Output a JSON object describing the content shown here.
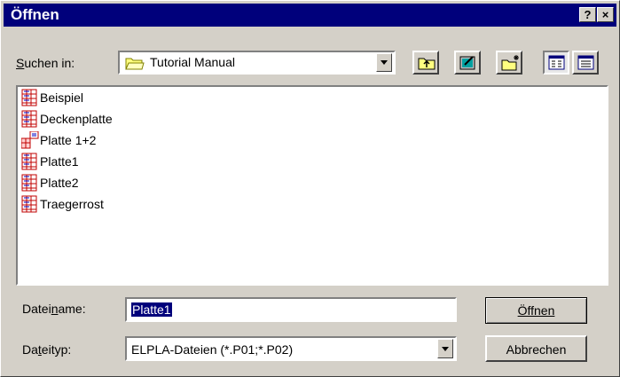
{
  "window": {
    "title": "Öffnen",
    "help_button": "?",
    "close_button": "×"
  },
  "look_in": {
    "label_pre": "",
    "label_mn": "S",
    "label_post": "uchen in:",
    "value": "Tutorial Manual"
  },
  "files": [
    {
      "name": "Beispiel",
      "icon": "elpla-grid-icon"
    },
    {
      "name": "Deckenplatte",
      "icon": "elpla-grid-icon"
    },
    {
      "name": "Platte 1+2",
      "icon": "elpla-merged-icon"
    },
    {
      "name": "Platte1",
      "icon": "elpla-grid-icon"
    },
    {
      "name": "Platte2",
      "icon": "elpla-grid-icon"
    },
    {
      "name": "Traegerrost",
      "icon": "elpla-grid-icon"
    }
  ],
  "filename": {
    "label_pre": "Datei",
    "label_mn": "n",
    "label_post": "ame:",
    "value": "Platte1"
  },
  "filetype": {
    "label_pre": "Da",
    "label_mn": "t",
    "label_post": "eityp:",
    "value": "ELPLA-Dateien (*.P01;*.P02)"
  },
  "buttons": {
    "open": "Öffnen",
    "cancel": "Abbrechen"
  },
  "colors": {
    "title_bar": "#00007b",
    "selection": "#00007b",
    "face": "#d4d0c8"
  }
}
